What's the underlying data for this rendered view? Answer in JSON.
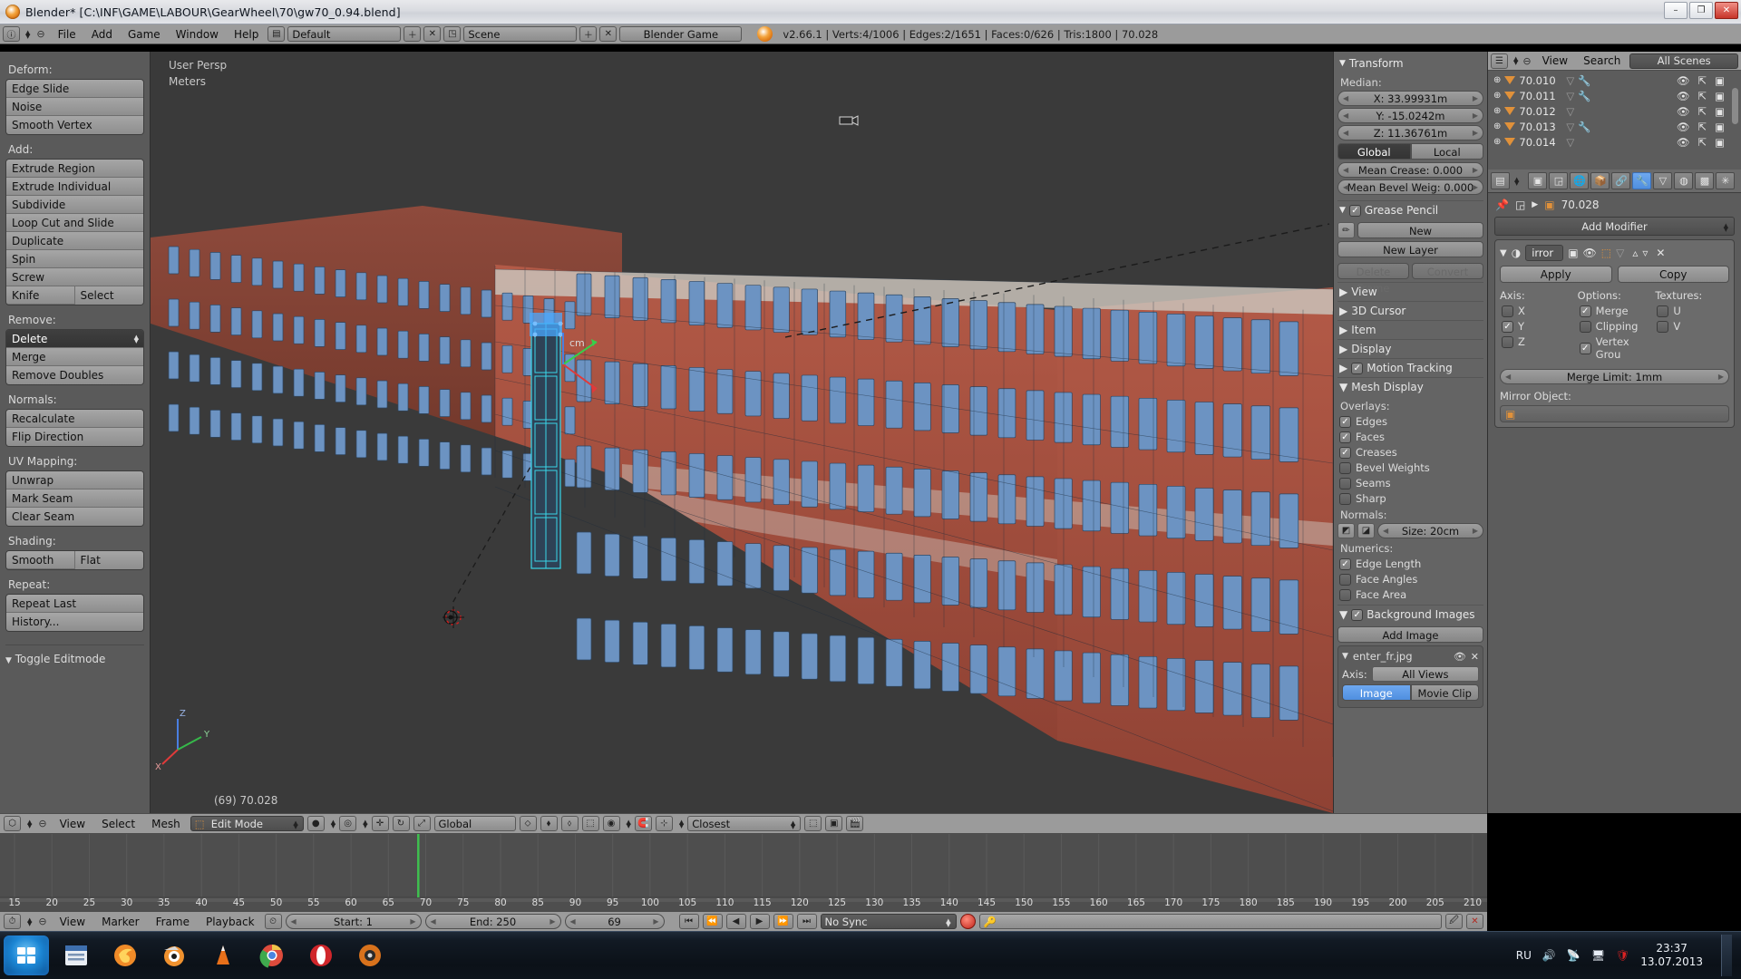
{
  "window": {
    "title": "Blender* [C:\\INF\\GAME\\LABOUR\\GearWheel\\70\\gw70_0.94.blend]",
    "minimize": "–",
    "maximize": "❐",
    "close": "✕"
  },
  "topbar": {
    "menus": [
      "File",
      "Add",
      "Game",
      "Window",
      "Help"
    ],
    "screen_layout": "Default",
    "scene": "Scene",
    "engine": "Blender Game",
    "stats": "v2.66.1 | Verts:4/1006 | Edges:2/1651 | Faces:0/626 | Tris:1800 | 70.028",
    "add_icon": "＋",
    "remove_icon": "✕"
  },
  "toolshelf": {
    "sections": [
      {
        "label": "Deform:",
        "buttons": [
          "Edge Slide",
          "Noise",
          "Smooth Vertex"
        ]
      },
      {
        "label": "Add:",
        "buttons": [
          "Extrude Region",
          "Extrude Individual",
          "Subdivide",
          "Loop Cut and Slide",
          "Duplicate",
          "Spin",
          "Screw"
        ],
        "pair": [
          "Knife",
          "Select"
        ]
      },
      {
        "label": "Remove:",
        "selected": "Delete",
        "buttons": [
          "Merge",
          "Remove Doubles"
        ]
      },
      {
        "label": "Normals:",
        "buttons": [
          "Recalculate",
          "Flip Direction"
        ]
      },
      {
        "label": "UV Mapping:",
        "buttons": [
          "Unwrap",
          "Mark Seam",
          "Clear Seam"
        ]
      },
      {
        "label": "Shading:",
        "pair": [
          "Smooth",
          "Flat"
        ]
      },
      {
        "label": "Repeat:",
        "buttons": [
          "Repeat Last",
          "History..."
        ]
      }
    ],
    "toggle_editmode": "Toggle Editmode"
  },
  "viewport": {
    "view_name": "User Persp",
    "units": "Meters",
    "object_label": "(69) 70.028",
    "edge_length_label": "cm",
    "axis_x": "X",
    "axis_y": "Y",
    "axis_z": "Z"
  },
  "npanel": {
    "transform": {
      "title": "Transform",
      "median_label": "Median:",
      "x": "X: 33.99931m",
      "y": "Y: -15.0242m",
      "z": "Z: 11.36761m",
      "space": [
        "Global",
        "Local"
      ],
      "space_active": "Global",
      "mean_crease": "Mean Crease: 0.000",
      "mean_bevel": "Mean Bevel Weig: 0.000"
    },
    "grease_pencil": {
      "title": "Grease Pencil",
      "new": "New",
      "new_layer": "New Layer",
      "delete_frame": "Delete Frame",
      "convert": "Convert"
    },
    "collapsed": [
      "View",
      "3D Cursor",
      "Item",
      "Display"
    ],
    "motion_tracking": "Motion Tracking",
    "mesh_display": {
      "title": "Mesh Display",
      "overlays_label": "Overlays:",
      "overlays": [
        {
          "label": "Edges",
          "checked": true
        },
        {
          "label": "Faces",
          "checked": true
        },
        {
          "label": "Creases",
          "checked": true
        },
        {
          "label": "Bevel Weights",
          "checked": false
        },
        {
          "label": "Seams",
          "checked": false
        },
        {
          "label": "Sharp",
          "checked": false
        }
      ],
      "normals_label": "Normals:",
      "normal_size": "Size: 20cm",
      "numerics_label": "Numerics:",
      "numerics": [
        {
          "label": "Edge Length",
          "checked": true
        },
        {
          "label": "Face Angles",
          "checked": false
        },
        {
          "label": "Face Area",
          "checked": false
        }
      ]
    },
    "background_images": {
      "title": "Background Images",
      "add_image": "Add Image",
      "image_name": "enter_fr.jpg",
      "axis_label": "Axis:",
      "axis_value": "All Views",
      "source": [
        "Image",
        "Movie Clip"
      ],
      "source_active": "Image"
    }
  },
  "outliner": {
    "view": "View",
    "search": "Search",
    "display_mode": "All Scenes",
    "rows": [
      {
        "name": "70.010",
        "modifier": true
      },
      {
        "name": "70.011",
        "modifier": true
      },
      {
        "name": "70.012",
        "modifier": false
      },
      {
        "name": "70.013",
        "modifier": true
      },
      {
        "name": "70.014",
        "modifier": false
      }
    ]
  },
  "properties": {
    "breadcrumb_object": "70.028",
    "add_modifier": "Add Modifier",
    "modifier": {
      "name": "irror",
      "apply": "Apply",
      "copy": "Copy",
      "axis_label": "Axis:",
      "options_label": "Options:",
      "textures_label": "Textures:",
      "axis": [
        {
          "label": "X",
          "checked": false
        },
        {
          "label": "Y",
          "checked": true
        },
        {
          "label": "Z",
          "checked": false
        }
      ],
      "options": [
        {
          "label": "Merge",
          "checked": true
        },
        {
          "label": "Clipping",
          "checked": false
        },
        {
          "label": "Vertex Grou",
          "checked": true
        }
      ],
      "textures": [
        {
          "label": "U",
          "checked": false
        },
        {
          "label": "V",
          "checked": false
        }
      ],
      "merge_limit": "Merge Limit: 1mm",
      "mirror_object_label": "Mirror Object:",
      "mirror_object_value": ""
    }
  },
  "vp_header": {
    "menus": [
      "View",
      "Select",
      "Mesh"
    ],
    "mode": "Edit Mode",
    "orientation": "Global",
    "snap_target": "Closest"
  },
  "timeline": {
    "menus": [
      "View",
      "Marker",
      "Frame",
      "Playback"
    ],
    "start": "Start: 1",
    "end": "End: 250",
    "current_frame": "69",
    "sync_mode": "No Sync",
    "ticks": [
      15,
      20,
      25,
      30,
      35,
      40,
      45,
      50,
      55,
      60,
      65,
      70,
      75,
      80,
      85,
      90,
      95,
      100,
      105,
      110,
      115,
      120,
      125,
      130,
      135,
      140,
      145,
      150,
      155,
      160,
      165,
      170,
      175,
      180,
      185,
      190,
      195,
      200,
      205,
      210
    ],
    "playhead": 69
  },
  "taskbar": {
    "apps": [
      "start-orb",
      "explorer",
      "firefox",
      "blender",
      "vlc",
      "chrome",
      "opera",
      "media-player"
    ],
    "language": "RU",
    "time": "23:37",
    "date": "13.07.2013"
  },
  "colors": {
    "accent_blue": "#4f8fe0",
    "orange": "#e0913a",
    "header_gray": "#9b9b9b",
    "panel_gray": "#646464",
    "viewport_bg": "#3a3a3a",
    "brick": "#a8503f",
    "playhead_green": "#3fbf4f"
  }
}
